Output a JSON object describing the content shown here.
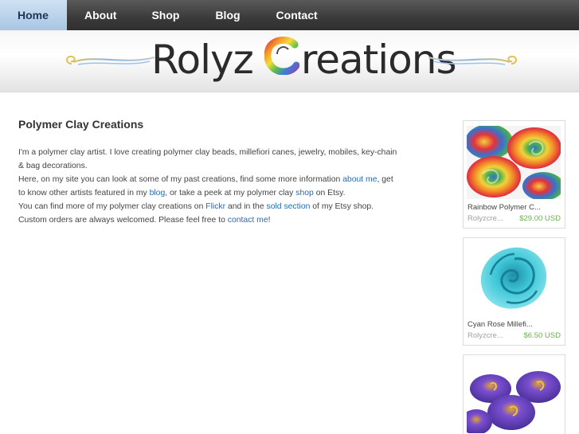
{
  "nav": {
    "items": [
      {
        "label": "Home"
      },
      {
        "label": "About"
      },
      {
        "label": "Shop"
      },
      {
        "label": "Blog"
      },
      {
        "label": "Contact"
      }
    ]
  },
  "header": {
    "logo_word1": "Rolyz",
    "logo_word2": "reations"
  },
  "main": {
    "title": "Polymer Clay Creations",
    "p1": "I'm a polymer clay artist. I love creating polymer clay beads, millefiori canes, jewelry, mobiles, key-chain & bag decorations.",
    "p2_a": "Here, on my site you can look at some of my past creations, find some more information ",
    "p2_link_about": "about me",
    "p2_b": ", get to know other artists featured in my ",
    "p2_link_blog": "blog",
    "p2_c": ", or take a peek at my polymer clay ",
    "p2_link_shop": "shop",
    "p2_d": " on Etsy.",
    "p3_a": "You can find more of my polymer clay creations on ",
    "p3_link_flickr": "Flickr",
    "p3_b": " and in the ",
    "p3_link_sold": "sold section",
    "p3_c": " of my Etsy shop.",
    "p4_a": "Custom orders are always welcomed. Please feel free to ",
    "p4_link_contact": "contact me",
    "p4_b": "!"
  },
  "sidebar": {
    "cards": [
      {
        "title": "Rainbow Polymer C...",
        "seller": "Rolyzcre...",
        "price": "$29.00 USD"
      },
      {
        "title": "Cyan Rose Millefi...",
        "seller": "Rolyzcre...",
        "price": "$6.50 USD"
      }
    ]
  },
  "colors": {
    "nav_bg": "#3a3a3a",
    "nav_active": "#b9d3ec",
    "link": "#2a6ab3",
    "price": "#67b24a"
  }
}
